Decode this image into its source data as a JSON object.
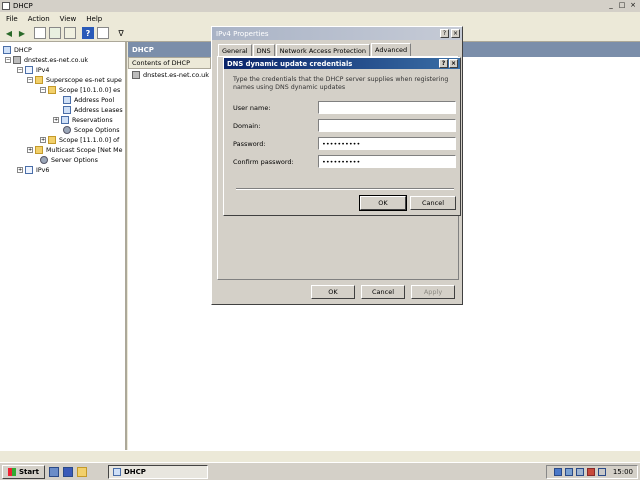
{
  "window": {
    "title": "DHCP",
    "controls": [
      "_",
      "□",
      "×"
    ]
  },
  "menu": [
    "File",
    "Action",
    "View",
    "Help"
  ],
  "tree": [
    {
      "label": "DHCP",
      "icon": "dhcp-icon",
      "expander": ""
    },
    {
      "label": "dnstest.es-net.co.uk",
      "icon": "server-icon",
      "expander": "−"
    },
    {
      "label": "IPv4",
      "icon": "ipv4-icon",
      "expander": "−"
    },
    {
      "label": "Superscope es-net supe",
      "icon": "folder-icon",
      "expander": "−"
    },
    {
      "label": "Scope [10.1.0.0] es",
      "icon": "folder-icon",
      "expander": "−"
    },
    {
      "label": "Address Pool",
      "icon": "pool-icon",
      "expander": ""
    },
    {
      "label": "Address Leases",
      "icon": "leases-icon",
      "expander": ""
    },
    {
      "label": "Reservations",
      "icon": "reservations-icon",
      "expander": "+"
    },
    {
      "label": "Scope Options",
      "icon": "options-icon",
      "expander": ""
    },
    {
      "label": "Scope [11.1.0.0] of",
      "icon": "folder-icon",
      "expander": "+"
    },
    {
      "label": "Multicast Scope [Net Me",
      "icon": "folder-icon",
      "expander": "+"
    },
    {
      "label": "Server Options",
      "icon": "options-icon",
      "expander": ""
    },
    {
      "label": "IPv6",
      "icon": "ipv6-icon",
      "expander": "+"
    }
  ],
  "right_pane": {
    "header": "DHCP",
    "column": "Contents of DHCP",
    "item": "dnstest.es-net.co.uk"
  },
  "properties_dialog": {
    "title": "IPv4 Properties",
    "tabs": [
      "General",
      "DNS",
      "Network Access Protection",
      "Advanced"
    ],
    "active_tab": "Advanced",
    "buttons": {
      "ok": "OK",
      "cancel": "Cancel",
      "apply": "Apply"
    },
    "title_buttons": [
      "?",
      "×"
    ]
  },
  "credentials_dialog": {
    "title": "DNS dynamic update credentials",
    "description": "Type the credentials that the DHCP server supplies when registering names using DNS dynamic updates",
    "fields": {
      "username_label": "User name:",
      "username_value": "",
      "domain_label": "Domain:",
      "domain_value": "",
      "password_label": "Password:",
      "password_value": "••••••••••",
      "confirm_label": "Confirm password:",
      "confirm_value": "••••••••••"
    },
    "buttons": {
      "ok": "OK",
      "cancel": "Cancel"
    },
    "title_buttons": [
      "?",
      "×"
    ]
  },
  "taskbar": {
    "start": "Start",
    "task": "DHCP",
    "clock": "15:00"
  },
  "colors": {
    "active_title": "#0a246a",
    "inactive_title": "#a9b3c6",
    "pane_header": "#7b8eaa"
  }
}
